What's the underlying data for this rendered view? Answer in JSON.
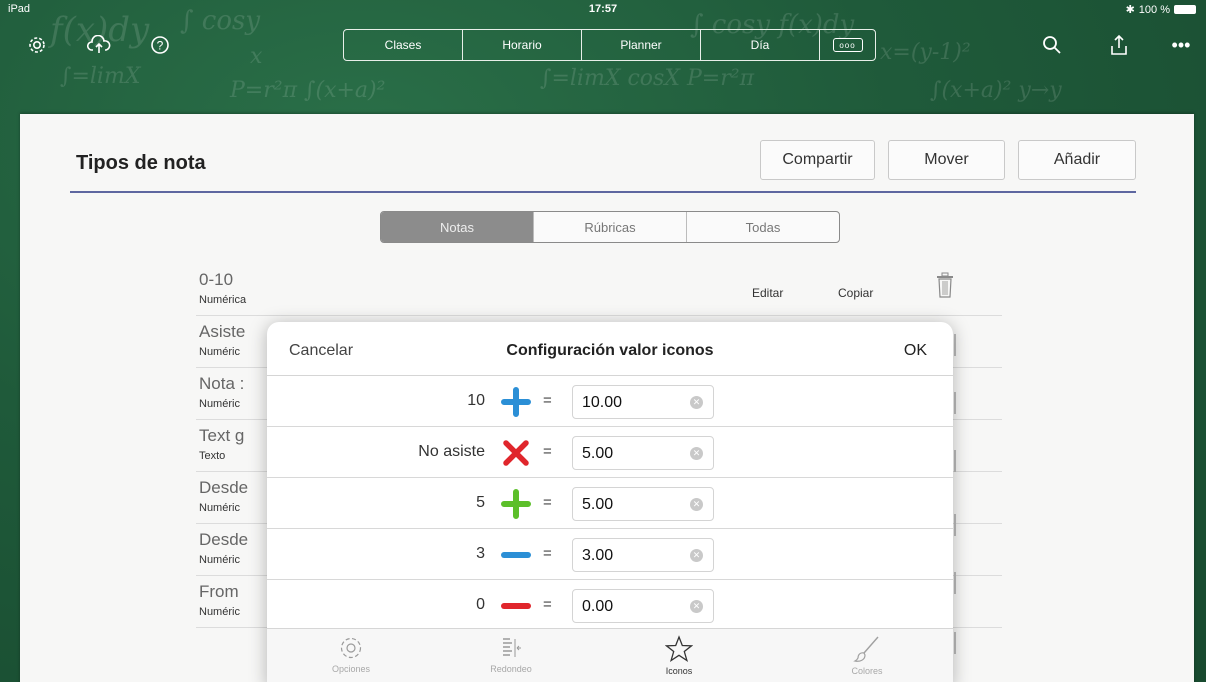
{
  "status_bar": {
    "device": "iPad",
    "time": "17:57",
    "battery": "100 %"
  },
  "top_tabs": [
    {
      "label": "Clases"
    },
    {
      "label": "Horario"
    },
    {
      "label": "Planner"
    },
    {
      "label": "Día"
    },
    {
      "label": "ooo"
    }
  ],
  "page": {
    "title": "Tipos de nota",
    "buttons": {
      "share": "Compartir",
      "move": "Mover",
      "add": "Añadir"
    },
    "filter_tabs": [
      {
        "label": "Notas",
        "active": true
      },
      {
        "label": "Rúbricas",
        "active": false
      },
      {
        "label": "Todas",
        "active": false
      }
    ],
    "list": [
      {
        "name": "0-10",
        "type": "Numérica"
      },
      {
        "name": "Asiste",
        "type": "Numéric"
      },
      {
        "name": "Nota :",
        "type": "Numéric"
      },
      {
        "name": "Text g",
        "type": "Texto"
      },
      {
        "name": "Desde",
        "type": "Numéric"
      },
      {
        "name": "Desde",
        "type": "Numéric"
      },
      {
        "name": "From",
        "type": "Numéric"
      }
    ],
    "row_actions": {
      "edit": "Editar",
      "copy": "Copiar"
    }
  },
  "dialog": {
    "cancel": "Cancelar",
    "title": "Configuración valor iconos",
    "ok": "OK",
    "rows": [
      {
        "label": "10",
        "icon": "blue-plus-icon",
        "value": "10.00"
      },
      {
        "label": "No asiste",
        "icon": "red-x-icon",
        "value": "5.00"
      },
      {
        "label": "5",
        "icon": "green-plus-icon",
        "value": "5.00"
      },
      {
        "label": "3",
        "icon": "blue-minus-icon",
        "value": "3.00"
      },
      {
        "label": "0",
        "icon": "red-minus-icon",
        "value": "0.00"
      }
    ],
    "equals": "=",
    "tab_bar": [
      {
        "label": "Opciones",
        "icon": "gear-icon",
        "active": false
      },
      {
        "label": "Redondeo",
        "icon": "rounding-icon",
        "active": false
      },
      {
        "label": "Iconos",
        "icon": "star-icon",
        "active": true
      },
      {
        "label": "Colores",
        "icon": "brush-icon",
        "active": false
      }
    ]
  },
  "colors": {
    "board": "#1f5a3a",
    "accent_rule": "#5e67a0",
    "blue": "#2b8fd6",
    "red": "#e0262c",
    "green": "#5cbf2a"
  }
}
